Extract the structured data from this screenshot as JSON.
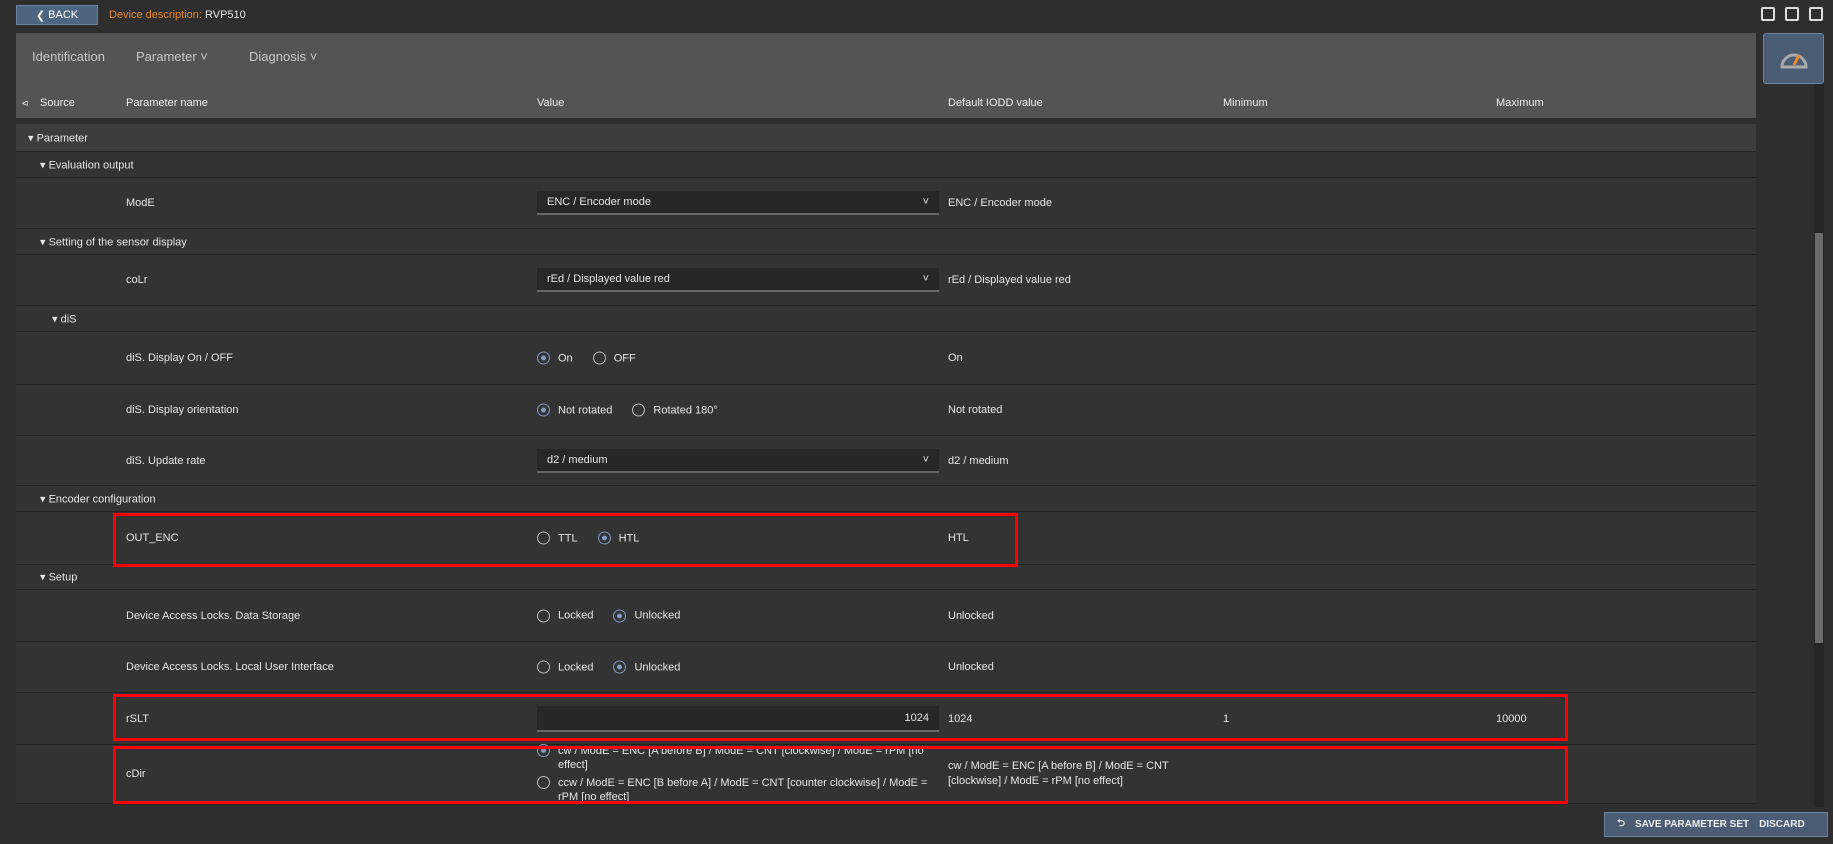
{
  "header": {
    "back_label": "BACK",
    "title_label": "Device description:",
    "device": "RVP510"
  },
  "toolbar_icons": [
    "copy-icon",
    "xml-export-icon",
    "print-icon"
  ],
  "nav": {
    "tabs": [
      {
        "label": "Identification"
      },
      {
        "label": "Parameter ˅"
      },
      {
        "label": "Diagnosis ˅"
      }
    ],
    "gauge_icon": "speedometer-icon"
  },
  "columns": {
    "source": "Source",
    "name": "Parameter name",
    "value": "Value",
    "default": "Default IODD value",
    "min": "Minimum",
    "max": "Maximum"
  },
  "rows": [
    {
      "type": "group",
      "level": 0,
      "label": "Parameter"
    },
    {
      "type": "group",
      "level": 1,
      "label": "Evaluation output"
    },
    {
      "type": "select",
      "name": "ModE",
      "value": "ENC / Encoder mode",
      "default": "ENC / Encoder mode"
    },
    {
      "type": "group",
      "level": 1,
      "label": "Setting of the sensor display"
    },
    {
      "type": "select",
      "name": "coLr",
      "value": "rEd / Displayed value red",
      "default": "rEd / Displayed value red"
    },
    {
      "type": "group",
      "level": 2,
      "label": "diS"
    },
    {
      "type": "radio",
      "name": "diS. Display On / OFF",
      "options": [
        "On",
        "OFF"
      ],
      "selected": 0,
      "default": "On"
    },
    {
      "type": "radio",
      "name": "diS. Display orientation",
      "options": [
        "Not rotated",
        "Rotated 180°"
      ],
      "selected": 0,
      "default": "Not rotated"
    },
    {
      "type": "select",
      "name": "diS. Update rate",
      "value": "d2 / medium",
      "default": "d2 / medium"
    },
    {
      "type": "group",
      "level": 1,
      "label": "Encoder configuration"
    },
    {
      "type": "radio",
      "name": "OUT_ENC",
      "options": [
        "TTL",
        "HTL"
      ],
      "selected": 1,
      "default": "HTL",
      "highlight": true
    },
    {
      "type": "group",
      "level": 1,
      "label": "Setup"
    },
    {
      "type": "radio",
      "name": "Device Access Locks. Data Storage",
      "options": [
        "Locked",
        "Unlocked"
      ],
      "selected": 1,
      "default": "Unlocked"
    },
    {
      "type": "radio",
      "name": "Device Access Locks. Local User Interface",
      "options": [
        "Locked",
        "Unlocked"
      ],
      "selected": 1,
      "default": "Unlocked"
    },
    {
      "type": "input",
      "name": "rSLT",
      "value": "1024",
      "default": "1024",
      "min": "1",
      "max": "10000",
      "highlight": true
    },
    {
      "type": "radio2",
      "name": "cDir",
      "options": [
        "cw / ModE = ENC [A before B] / ModE = CNT [clockwise] / ModE = rPM [no effect]",
        "ccw / ModE = ENC [B before A] / ModE = CNT [counter clockwise] / ModE = rPM [no effect]"
      ],
      "selected": 0,
      "default": "cw / ModE = ENC [A before B] / ModE = CNT [clockwise] / ModE = rPM [no effect]",
      "highlight": true
    }
  ],
  "help_glyph": "?",
  "footer": {
    "save": "SAVE PARAMETER SET",
    "discard": "DISCARD",
    "undo_icon": "undo-icon"
  },
  "colors": {
    "accent": "#4b5d75",
    "highlight": "#ff0000",
    "title_label": "#e8892a"
  }
}
